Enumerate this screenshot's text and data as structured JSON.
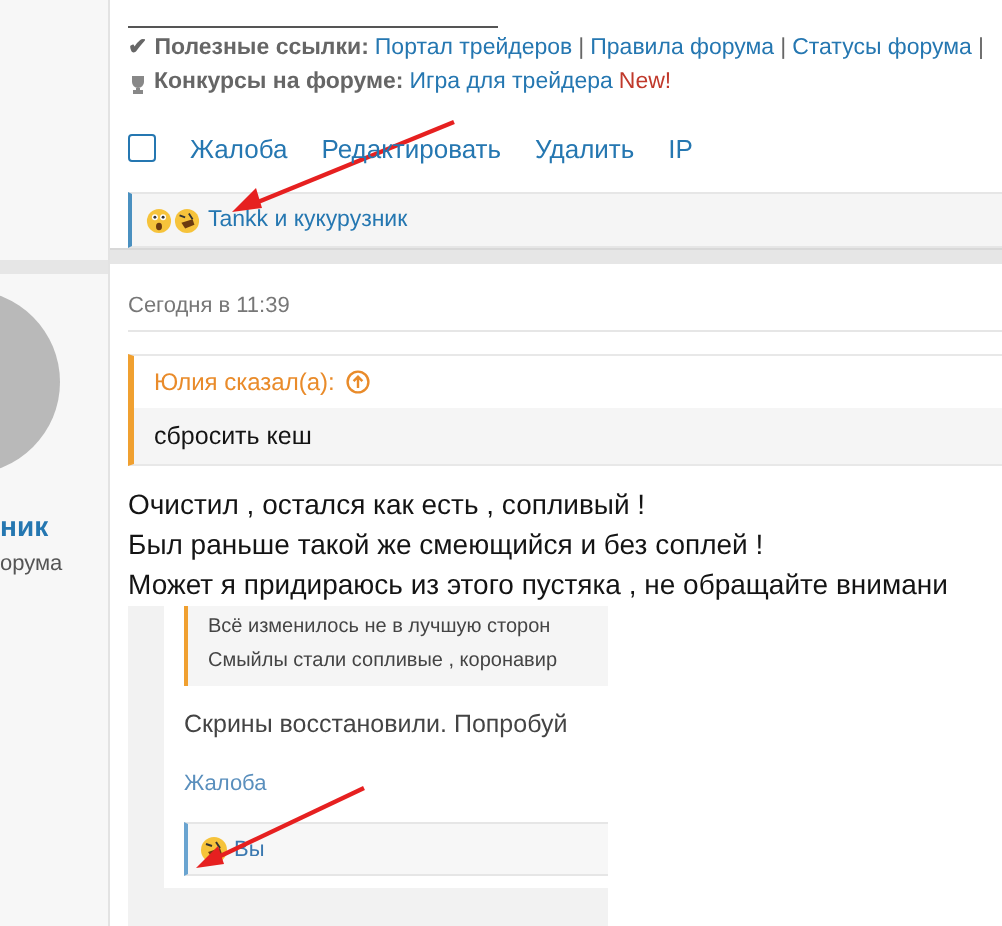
{
  "previous_post": {
    "links_line": {
      "label": "✔ Полезные ссылки:",
      "parts": [
        {
          "kind": "link",
          "text": "Портал трейдеров"
        },
        {
          "kind": "separator",
          "text": "|"
        },
        {
          "kind": "link",
          "text": "Правила форума"
        },
        {
          "kind": "separator",
          "text": "|"
        },
        {
          "kind": "link",
          "text": "Статусы форума"
        },
        {
          "kind": "separator",
          "text": "|"
        }
      ]
    },
    "contests_line": {
      "label": "Конкурсы на форуме:",
      "link": "Игра для трейдера",
      "badge": "New!"
    },
    "select_checkbox": {
      "checked": false
    },
    "actions": [
      "Жалоба",
      "Редактировать",
      "Удалить",
      "IP"
    ],
    "reactions": {
      "text": "Tankk и кукурузник"
    }
  },
  "post": {
    "author": {
      "name": "ник",
      "title": "орума"
    },
    "date": "Сегодня в 11:39",
    "quote": {
      "author": "Юлия сказал(а):",
      "text": "сбросить кеш"
    },
    "message_lines": [
      "Очистил , остался как есть , сопливый !",
      "Был раньше такой же смеющийся и без соплей !",
      "Может я придираюсь из этого пустяка , не обращайте внимани"
    ],
    "embedded_screenshot": {
      "quote_lines": [
        "Всё изменилось не в лучшую сторон",
        "Смыйлы стали сопливые , коронавир"
      ],
      "text": "Скрины восстановили. Попробуй",
      "action": "Жалоба",
      "reactions": {
        "text": "Вы"
      }
    }
  }
}
